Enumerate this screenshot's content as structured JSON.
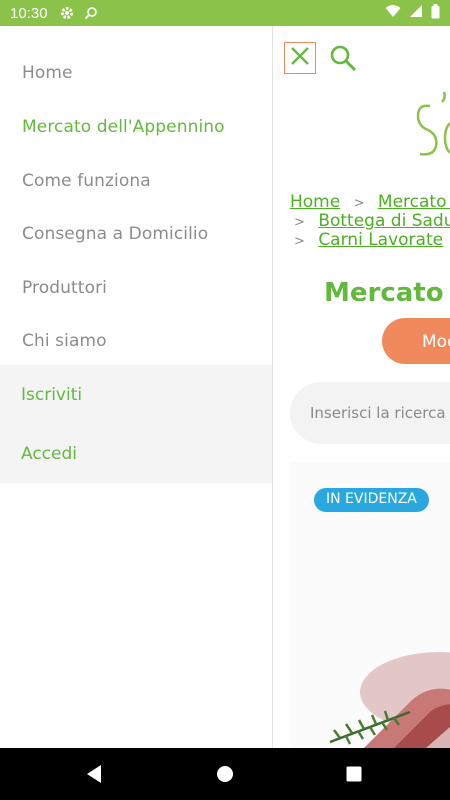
{
  "status_bar": {
    "time": "10:30",
    "icons": [
      "settings-icon",
      "search-icon",
      "wifi-icon",
      "signal-icon",
      "battery-icon"
    ],
    "color": "#8bc34a"
  },
  "drawer": {
    "items": [
      {
        "label": "Home",
        "active": false
      },
      {
        "label": "Mercato dell'Appennino",
        "active": true
      },
      {
        "label": "Come funziona",
        "active": false
      },
      {
        "label": "Consegna a Domicilio",
        "active": false
      },
      {
        "label": "Produttori",
        "active": false
      },
      {
        "label": "Chi siamo",
        "active": false
      }
    ],
    "auth": [
      {
        "label": "Iscriviti"
      },
      {
        "label": "Accedi"
      }
    ]
  },
  "content": {
    "logo_text": "So",
    "breadcrumb": {
      "home": "Home",
      "mercato": "Mercato dell'Appennino",
      "bottega": "Bottega di Saduria",
      "carni": "Carni Lavorate"
    },
    "title": "Mercato dell'Appennino",
    "mode_button": "Modalità",
    "search_placeholder": "Inserisci la ricerca",
    "badge": "IN EVIDENZA"
  },
  "colors": {
    "accent_green": "#63b93e",
    "link_green": "#4caf24",
    "orange": "#f08a5d",
    "badge_blue": "#29a8e0"
  }
}
